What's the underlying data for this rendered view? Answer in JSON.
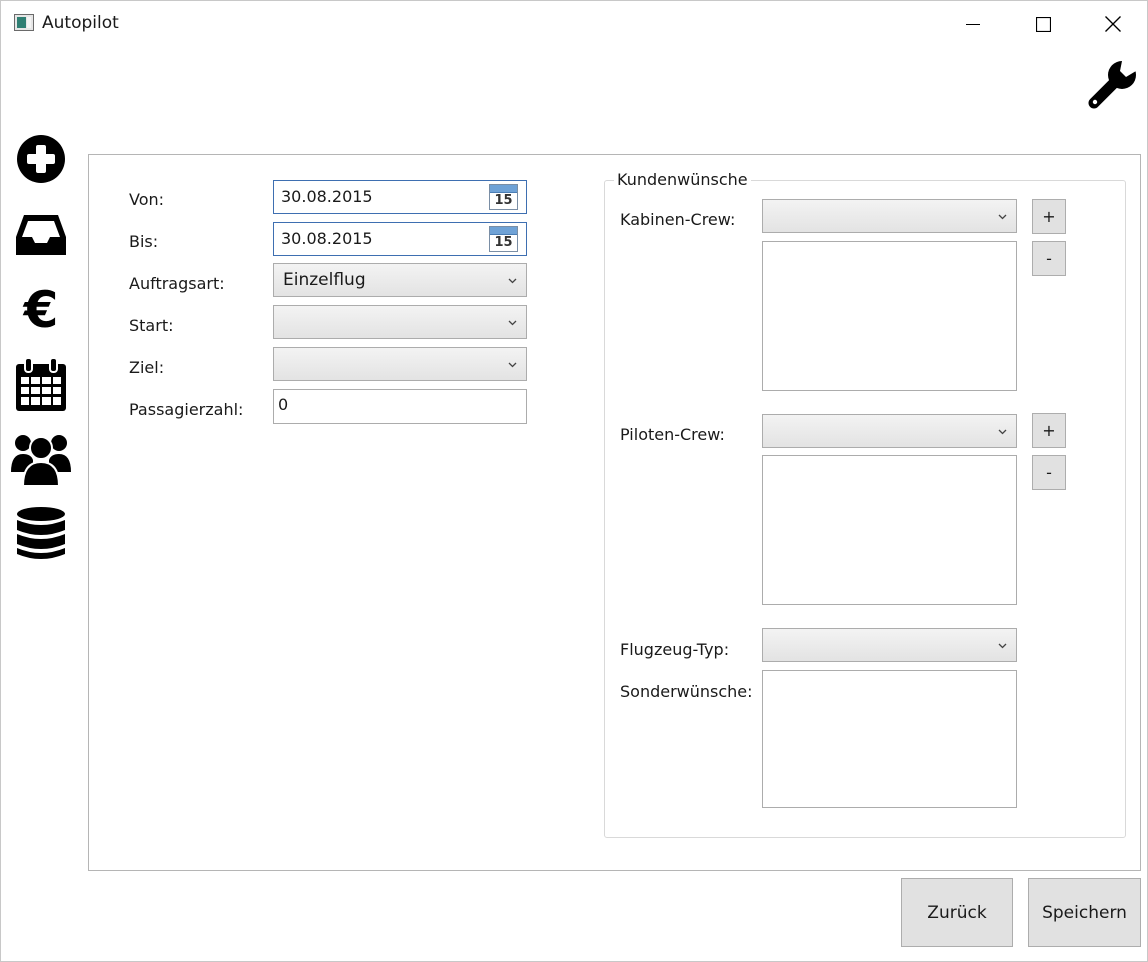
{
  "window": {
    "title": "Autopilot",
    "controls": [
      "minimize-icon",
      "maximize-icon",
      "close-icon"
    ]
  },
  "toolbar": {
    "settings_icon": "wrench-icon"
  },
  "sidebar": {
    "items": [
      {
        "icon": "add-circle-icon"
      },
      {
        "icon": "inbox-icon"
      },
      {
        "icon": "euro-icon"
      },
      {
        "icon": "calendar-icon"
      },
      {
        "icon": "users-icon"
      },
      {
        "icon": "database-icon"
      }
    ]
  },
  "form": {
    "von_label": "Von:",
    "von_value": "30.08.2015",
    "bis_label": "Bis:",
    "bis_value": "30.08.2015",
    "calendar_day": "15",
    "auftragsart_label": "Auftragsart:",
    "auftragsart_value": "Einzelflug",
    "start_label": "Start:",
    "start_value": "",
    "ziel_label": "Ziel:",
    "ziel_value": "",
    "passagierzahl_label": "Passagierzahl:",
    "passagierzahl_value": "0"
  },
  "kundenwuensche": {
    "title": "Kundenwünsche",
    "kabinen_crew_label": "Kabinen-Crew:",
    "kabinen_crew_value": "",
    "piloten_crew_label": "Piloten-Crew:",
    "piloten_crew_value": "",
    "flugzeug_typ_label": "Flugzeug-Typ:",
    "flugzeug_typ_value": "",
    "sonderwuensche_label": "Sonderwünsche:",
    "sonderwuensche_value": "",
    "add_label": "+",
    "remove_label": "-"
  },
  "footer": {
    "back_label": "Zurück",
    "save_label": "Speichern"
  },
  "colors": {
    "accent_border": "#3e6fb1",
    "button_bg": "#e1e1e1",
    "icon": "#000000"
  }
}
